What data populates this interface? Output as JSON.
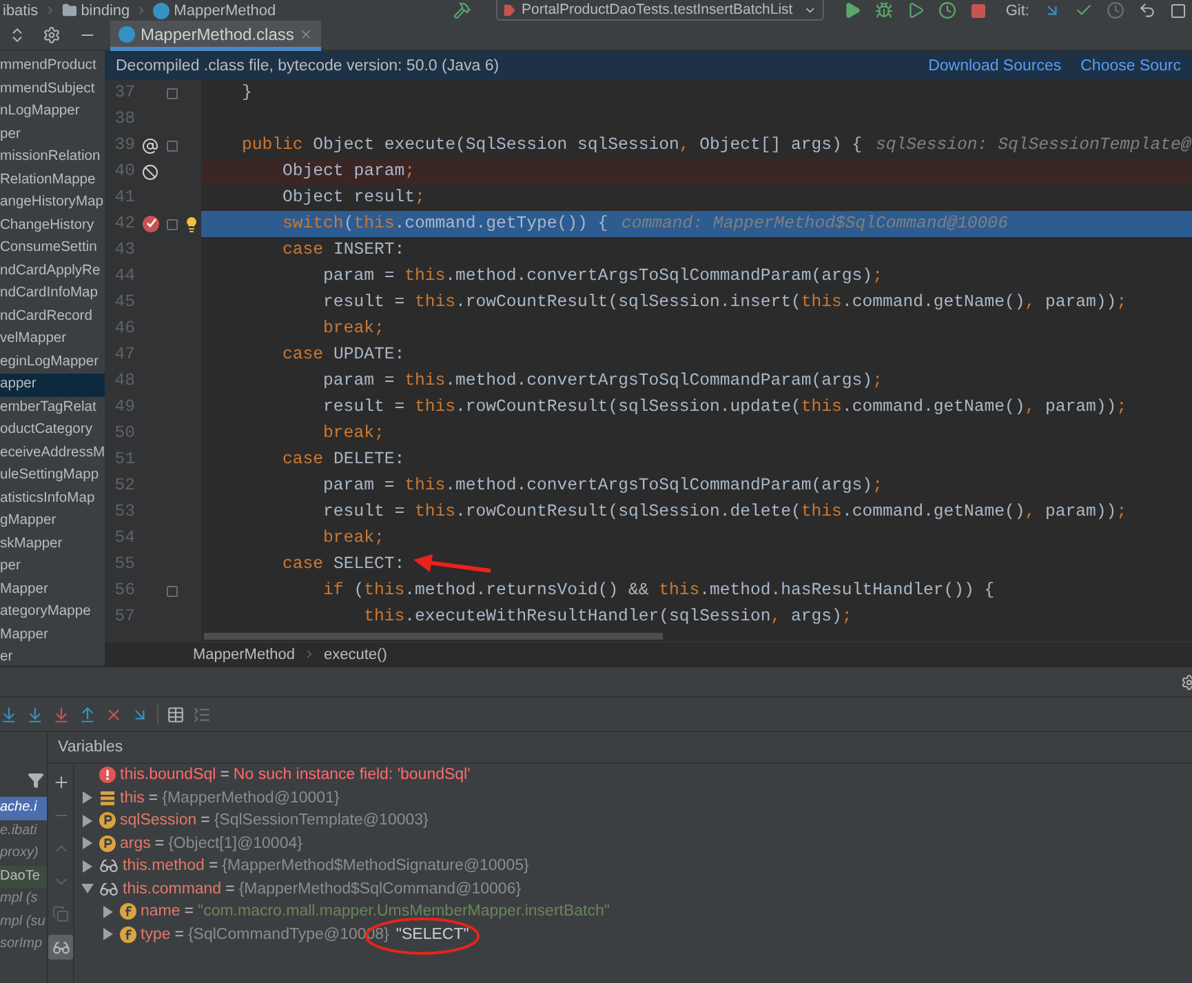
{
  "nav_bar": {
    "breadcrumbs": [
      {
        "kind": "text",
        "label": "ibatis"
      },
      {
        "kind": "folder",
        "label": "binding"
      },
      {
        "kind": "class",
        "label": "MapperMethod"
      }
    ],
    "run_config": "PortalProductDaoTests.testInsertBatchList",
    "vcs_label": "Git:"
  },
  "editor_tabs": [
    {
      "label": "MapperMethod.class",
      "selected": true
    }
  ],
  "project_panel": {
    "items": [
      {
        "label": "mmendProduct",
        "selected": false
      },
      {
        "label": "mmendSubject",
        "selected": false
      },
      {
        "label": "nLogMapper",
        "selected": false
      },
      {
        "label": "per",
        "selected": false
      },
      {
        "label": "missionRelation",
        "selected": false
      },
      {
        "label": "RelationMappe",
        "selected": false
      },
      {
        "label": "angeHistoryMap",
        "selected": false
      },
      {
        "label": "ChangeHistory",
        "selected": false
      },
      {
        "label": "ConsumeSettin",
        "selected": false
      },
      {
        "label": "ndCardApplyRe",
        "selected": false
      },
      {
        "label": "ndCardInfoMap",
        "selected": false
      },
      {
        "label": "ndCardRecord",
        "selected": false
      },
      {
        "label": "velMapper",
        "selected": false
      },
      {
        "label": "eginLogMapper",
        "selected": false
      },
      {
        "label": "apper",
        "selected": true
      },
      {
        "label": "emberTagRelat",
        "selected": false
      },
      {
        "label": "oductCategory",
        "selected": false
      },
      {
        "label": "eceiveAddressM",
        "selected": false
      },
      {
        "label": "uleSettingMapp",
        "selected": false
      },
      {
        "label": "atisticsInfoMap",
        "selected": false
      },
      {
        "label": "gMapper",
        "selected": false
      },
      {
        "label": "skMapper",
        "selected": false
      },
      {
        "label": "per",
        "selected": false
      },
      {
        "label": "Mapper",
        "selected": false
      },
      {
        "label": "ategoryMappe",
        "selected": false
      },
      {
        "label": "Mapper",
        "selected": false
      },
      {
        "label": "er",
        "selected": false
      }
    ]
  },
  "banner": {
    "message": "Decompiled .class file, bytecode version: 50.0 (Java 6)",
    "links": [
      "Download Sources",
      "Choose Sourc"
    ]
  },
  "code_lines": [
    {
      "number": "37",
      "foldable": true,
      "tokens": [
        {
          "kind": "plain",
          "text": "    }"
        }
      ]
    },
    {
      "number": "38"
    },
    {
      "number": "39",
      "foldable": true,
      "annotated": true,
      "tokens": [
        {
          "kind": "kw",
          "text": "    public"
        },
        {
          "kind": "plain",
          "text": " Object execute(SqlSession sqlSession"
        },
        {
          "kind": "kw",
          "text": ","
        },
        {
          "kind": "plain",
          "text": " Object[] args) {"
        },
        {
          "kind": "hint",
          "text": "sqlSession: SqlSessionTemplate@"
        }
      ]
    },
    {
      "number": "40",
      "muted_breakpoint": true,
      "tokens": [
        {
          "kind": "plain",
          "text": "        Object param"
        },
        {
          "kind": "kw",
          "text": ";"
        }
      ]
    },
    {
      "number": "41",
      "tokens": [
        {
          "kind": "plain",
          "text": "        Object result"
        },
        {
          "kind": "kw",
          "text": ";"
        }
      ]
    },
    {
      "number": "42",
      "foldable": true,
      "breakpoint": true,
      "current": true,
      "tokens": [
        {
          "kind": "kw",
          "text": "        switch"
        },
        {
          "kind": "plain",
          "text": "("
        },
        {
          "kind": "kw",
          "text": "this"
        },
        {
          "kind": "plain",
          "text": ".command.getType()) {"
        },
        {
          "kind": "hint",
          "text": "command: MapperMethod$SqlCommand@10006"
        }
      ]
    },
    {
      "number": "43",
      "tokens": [
        {
          "kind": "kw",
          "text": "        case"
        },
        {
          "kind": "plain",
          "text": " INSERT:"
        }
      ]
    },
    {
      "number": "44",
      "tokens": [
        {
          "kind": "plain",
          "text": "            param = "
        },
        {
          "kind": "kw",
          "text": "this"
        },
        {
          "kind": "plain",
          "text": ".method.convertArgsToSqlCommandParam(args)"
        },
        {
          "kind": "kw",
          "text": ";"
        }
      ]
    },
    {
      "number": "45",
      "tokens": [
        {
          "kind": "plain",
          "text": "            result = "
        },
        {
          "kind": "kw",
          "text": "this"
        },
        {
          "kind": "plain",
          "text": ".rowCountResult(sqlSession.insert("
        },
        {
          "kind": "kw",
          "text": "this"
        },
        {
          "kind": "plain",
          "text": ".command.getName()"
        },
        {
          "kind": "kw",
          "text": ","
        },
        {
          "kind": "plain",
          "text": " param))"
        },
        {
          "kind": "kw",
          "text": ";"
        }
      ]
    },
    {
      "number": "46",
      "tokens": [
        {
          "kind": "kw",
          "text": "            break;"
        }
      ]
    },
    {
      "number": "47",
      "tokens": [
        {
          "kind": "kw",
          "text": "        case"
        },
        {
          "kind": "plain",
          "text": " UPDATE:"
        }
      ]
    },
    {
      "number": "48",
      "tokens": [
        {
          "kind": "plain",
          "text": "            param = "
        },
        {
          "kind": "kw",
          "text": "this"
        },
        {
          "kind": "plain",
          "text": ".method.convertArgsToSqlCommandParam(args)"
        },
        {
          "kind": "kw",
          "text": ";"
        }
      ]
    },
    {
      "number": "49",
      "tokens": [
        {
          "kind": "plain",
          "text": "            result = "
        },
        {
          "kind": "kw",
          "text": "this"
        },
        {
          "kind": "plain",
          "text": ".rowCountResult(sqlSession.update("
        },
        {
          "kind": "kw",
          "text": "this"
        },
        {
          "kind": "plain",
          "text": ".command.getName()"
        },
        {
          "kind": "kw",
          "text": ","
        },
        {
          "kind": "plain",
          "text": " param))"
        },
        {
          "kind": "kw",
          "text": ";"
        }
      ]
    },
    {
      "number": "50",
      "tokens": [
        {
          "kind": "kw",
          "text": "            break;"
        }
      ]
    },
    {
      "number": "51",
      "tokens": [
        {
          "kind": "kw",
          "text": "        case"
        },
        {
          "kind": "plain",
          "text": " DELETE:"
        }
      ]
    },
    {
      "number": "52",
      "tokens": [
        {
          "kind": "plain",
          "text": "            param = "
        },
        {
          "kind": "kw",
          "text": "this"
        },
        {
          "kind": "plain",
          "text": ".method.convertArgsToSqlCommandParam(args)"
        },
        {
          "kind": "kw",
          "text": ";"
        }
      ]
    },
    {
      "number": "53",
      "tokens": [
        {
          "kind": "plain",
          "text": "            result = "
        },
        {
          "kind": "kw",
          "text": "this"
        },
        {
          "kind": "plain",
          "text": ".rowCountResult(sqlSession.delete("
        },
        {
          "kind": "kw",
          "text": "this"
        },
        {
          "kind": "plain",
          "text": ".command.getName()"
        },
        {
          "kind": "kw",
          "text": ","
        },
        {
          "kind": "plain",
          "text": " param))"
        },
        {
          "kind": "kw",
          "text": ";"
        }
      ]
    },
    {
      "number": "54",
      "tokens": [
        {
          "kind": "kw",
          "text": "            break;"
        }
      ]
    },
    {
      "number": "55",
      "tokens": [
        {
          "kind": "kw",
          "text": "        case"
        },
        {
          "kind": "plain",
          "text": " SELECT:"
        }
      ]
    },
    {
      "number": "56",
      "foldable": true,
      "tokens": [
        {
          "kind": "kw",
          "text": "            if"
        },
        {
          "kind": "plain",
          "text": " ("
        },
        {
          "kind": "kw",
          "text": "this"
        },
        {
          "kind": "plain",
          "text": ".method.returnsVoid() && "
        },
        {
          "kind": "kw",
          "text": "this"
        },
        {
          "kind": "plain",
          "text": ".method.hasResultHandler()) {"
        }
      ]
    },
    {
      "number": "57",
      "tokens": [
        {
          "kind": "kw",
          "text": "                this"
        },
        {
          "kind": "plain",
          "text": ".executeWithResultHandler(sqlSession"
        },
        {
          "kind": "kw",
          "text": ","
        },
        {
          "kind": "plain",
          "text": " args)"
        },
        {
          "kind": "kw",
          "text": ";"
        }
      ]
    }
  ],
  "editor_breadcrumbs": [
    "MapperMethod",
    "execute()"
  ],
  "debugger": {
    "frames": [
      {
        "label": "ache.i",
        "kind": "library",
        "selected": true
      },
      {
        "label": "e.ibati",
        "kind": "library",
        "selected": false
      },
      {
        "label": "proxy)",
        "kind": "library",
        "selected": false
      },
      {
        "label": "DaoTe",
        "kind": "project",
        "selected": false
      },
      {
        "label": "mpl (s",
        "kind": "library",
        "selected": false
      },
      {
        "label": "mpl (su",
        "kind": "library",
        "selected": false
      },
      {
        "label": "sorImp",
        "kind": "library",
        "selected": false
      }
    ],
    "variables_title": "Variables",
    "variables": [
      {
        "kind": "error",
        "name": "this.boundSql",
        "operator": "=",
        "value": "No such instance field: 'boundSql'"
      },
      {
        "kind": "object",
        "name": "this",
        "operator": "=",
        "value": "{MapperMethod@10001}",
        "quoted": false,
        "expanded": false
      },
      {
        "kind": "param",
        "name": "sqlSession",
        "operator": "=",
        "value": "{SqlSessionTemplate@10003}",
        "quoted": false,
        "expanded": false
      },
      {
        "kind": "param",
        "name": "args",
        "operator": "=",
        "value": "{Object[1]@10004}",
        "quoted": false,
        "expanded": false
      },
      {
        "kind": "watch",
        "name": "this.method",
        "operator": "=",
        "value": "{MapperMethod$MethodSignature@10005}",
        "quoted": false,
        "expanded": false
      },
      {
        "kind": "watch",
        "name": "this.command",
        "operator": "=",
        "value": "{MapperMethod$SqlCommand@10006}",
        "quoted": false,
        "expanded": true,
        "children": [
          {
            "kind": "field",
            "name": "name",
            "operator": "=",
            "value": "\"com.macro.mall.mapper.UmsMemberMapper.insertBatch\"",
            "quoted": true,
            "expanded": false
          },
          {
            "kind": "field",
            "name": "type",
            "operator": "=",
            "value": "{SqlCommandType@10008}",
            "display": "\"SELECT\"",
            "quoted": false,
            "expanded": false
          }
        ]
      }
    ]
  }
}
